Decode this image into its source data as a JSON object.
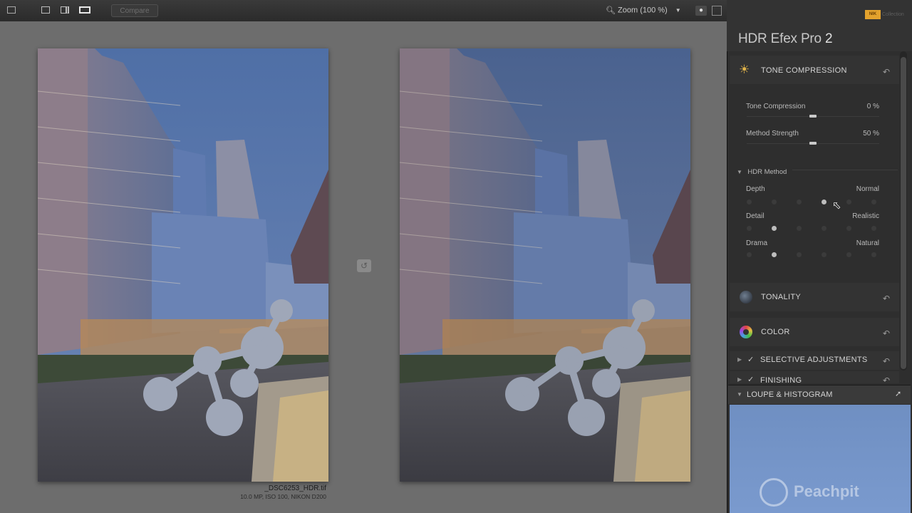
{
  "toolbar": {
    "compare_label": "Compare",
    "zoom_label": "Zoom (100 %)"
  },
  "images": {
    "filename": "_DSC6253_HDR.tif",
    "meta": "10.0 MP, ISO 100, NIKON D200"
  },
  "panel": {
    "brand_logo": "NIK",
    "brand_collection": "Collection",
    "product_name": "HDR Efex Pro",
    "product_version": "2",
    "tone_compression": {
      "title": "TONE COMPRESSION",
      "params": [
        {
          "label": "Tone Compression",
          "value": "0 %",
          "level": 0.5
        },
        {
          "label": "Method Strength",
          "value": "50 %",
          "level": 0.5
        }
      ]
    },
    "hdr_method": {
      "title": "HDR Method",
      "rows": [
        {
          "label": "Depth",
          "value": "Normal",
          "active_index": 3
        },
        {
          "label": "Detail",
          "value": "Realistic",
          "active_index": 1
        },
        {
          "label": "Drama",
          "value": "Natural",
          "active_index": 1
        }
      ]
    },
    "sections": {
      "tonality": "TONALITY",
      "color": "COLOR",
      "selective": "SELECTIVE ADJUSTMENTS",
      "finishing": "FINISHING"
    },
    "loupe": {
      "title": "LOUPE & HISTOGRAM",
      "watermark": "Peachpit"
    }
  }
}
